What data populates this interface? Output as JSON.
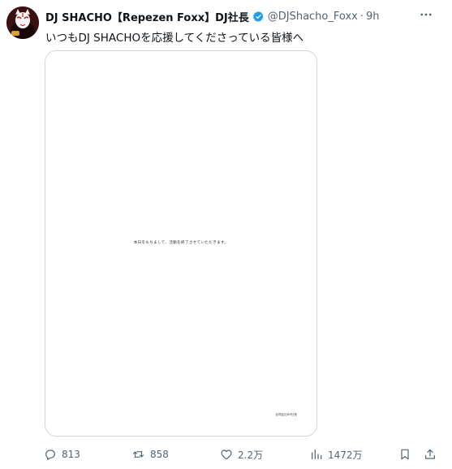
{
  "author": {
    "display_name": "DJ SHACHO【Repezen Foxx】DJ社長",
    "handle": "@DJShacho_Foxx",
    "separator": "·",
    "time": "9h",
    "verified_color": "#1d9bf0"
  },
  "tweet": {
    "text": "いつもDJ SHACHOを応援してくださっている皆様へ"
  },
  "media": {
    "document_line": "本日をもちまして、活動を終了させていただきます。",
    "signature": "合同会社RF社長"
  },
  "actions": {
    "replies": "813",
    "reposts": "858",
    "likes": "2.2万",
    "views": "1472万"
  },
  "icons": {
    "more": "more-horizontal-icon",
    "reply": "reply-icon",
    "repost": "repost-icon",
    "like": "heart-icon",
    "views": "views-chart-icon",
    "bookmark": "bookmark-icon",
    "share": "share-icon"
  },
  "colors": {
    "text_primary": "#0f1419",
    "text_secondary": "#536471",
    "border": "#cfd9de"
  }
}
